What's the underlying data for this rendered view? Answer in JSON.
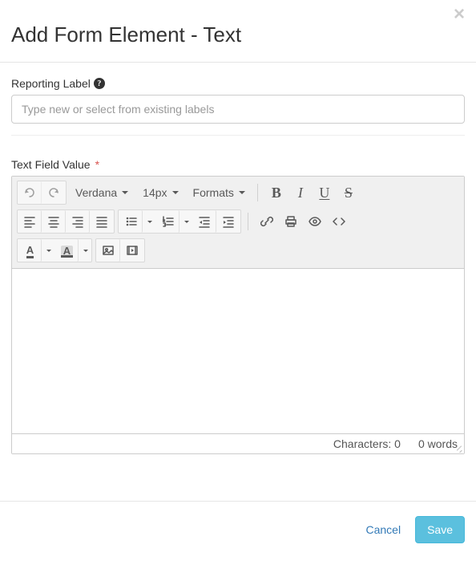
{
  "header": {
    "title": "Add Form Element - Text"
  },
  "fields": {
    "reporting_label": {
      "label": "Reporting Label",
      "placeholder": "Type new or select from existing labels",
      "value": ""
    },
    "text_field_value": {
      "label": "Text Field Value",
      "required_marker": "*"
    }
  },
  "editor": {
    "font_family": "Verdana",
    "font_size": "14px",
    "formats_label": "Formats",
    "status": {
      "characters_label": "Characters:",
      "characters_count": "0",
      "words_label": "words",
      "words_count": "0"
    }
  },
  "footer": {
    "cancel": "Cancel",
    "save": "Save"
  }
}
